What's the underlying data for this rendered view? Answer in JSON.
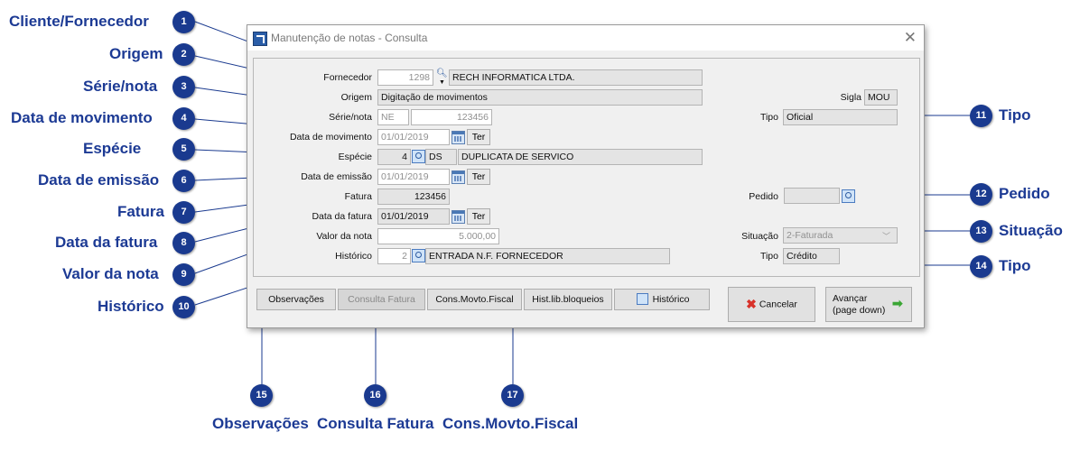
{
  "window": {
    "title": "Manutenção de notas - Consulta"
  },
  "form": {
    "fornecedor": {
      "label": "Fornecedor",
      "code": "1298",
      "name": "RECH INFORMATICA LTDA."
    },
    "origem": {
      "label": "Origem",
      "value": "Digitação de movimentos"
    },
    "sigla": {
      "label": "Sigla",
      "value": "MOU"
    },
    "serie_nota": {
      "label": "Série/nota",
      "serie": "NE",
      "nota": "123456"
    },
    "tipo1": {
      "label": "Tipo",
      "value": "Oficial"
    },
    "data_movimento": {
      "label": "Data de movimento",
      "value": "01/01/2019",
      "weekday": "Ter"
    },
    "especie": {
      "label": "Espécie",
      "code": "4",
      "abbr": "DS",
      "desc": "DUPLICATA DE SERVICO"
    },
    "data_emissao": {
      "label": "Data de emissão",
      "value": "01/01/2019",
      "weekday": "Ter"
    },
    "fatura": {
      "label": "Fatura",
      "value": "123456"
    },
    "pedido": {
      "label": "Pedido",
      "value": ""
    },
    "data_fatura": {
      "label": "Data da fatura",
      "value": "01/01/2019",
      "weekday": "Ter"
    },
    "valor_nota": {
      "label": "Valor da nota",
      "value": "5.000,00"
    },
    "situacao": {
      "label": "Situação",
      "value": "2-Faturada"
    },
    "historico": {
      "label": "Histórico",
      "code": "2",
      "desc": "ENTRADA N.F. FORNECEDOR"
    },
    "tipo2": {
      "label": "Tipo",
      "value": "Crédito"
    }
  },
  "buttons": {
    "observacoes": "Observações",
    "consulta_fatura": "Consulta Fatura",
    "cons_movto_fiscal": "Cons.Movto.Fiscal",
    "hist_lib_bloqueios": "Hist.lib.bloqueios",
    "historico": "Histórico",
    "cancelar": "Cancelar",
    "avancar_line1": "Avançar",
    "avancar_line2": "(page down)"
  },
  "callouts": [
    {
      "n": "1",
      "label": "Cliente/Fornecedor"
    },
    {
      "n": "2",
      "label": "Origem"
    },
    {
      "n": "3",
      "label": "Série/nota"
    },
    {
      "n": "4",
      "label": "Data de movimento"
    },
    {
      "n": "5",
      "label": "Espécie"
    },
    {
      "n": "6",
      "label": "Data de emissão"
    },
    {
      "n": "7",
      "label": "Fatura"
    },
    {
      "n": "8",
      "label": "Data da fatura"
    },
    {
      "n": "9",
      "label": "Valor da nota"
    },
    {
      "n": "10",
      "label": "Histórico"
    },
    {
      "n": "11",
      "label": "Tipo"
    },
    {
      "n": "12",
      "label": "Pedido"
    },
    {
      "n": "13",
      "label": "Situação"
    },
    {
      "n": "14",
      "label": "Tipo"
    },
    {
      "n": "15",
      "label": "Observações"
    },
    {
      "n": "16",
      "label": "Consulta Fatura"
    },
    {
      "n": "17",
      "label": "Cons.Movto.Fiscal"
    }
  ],
  "colors": {
    "callout": "#1a3a8f",
    "callout_text": "#1c3a94"
  }
}
